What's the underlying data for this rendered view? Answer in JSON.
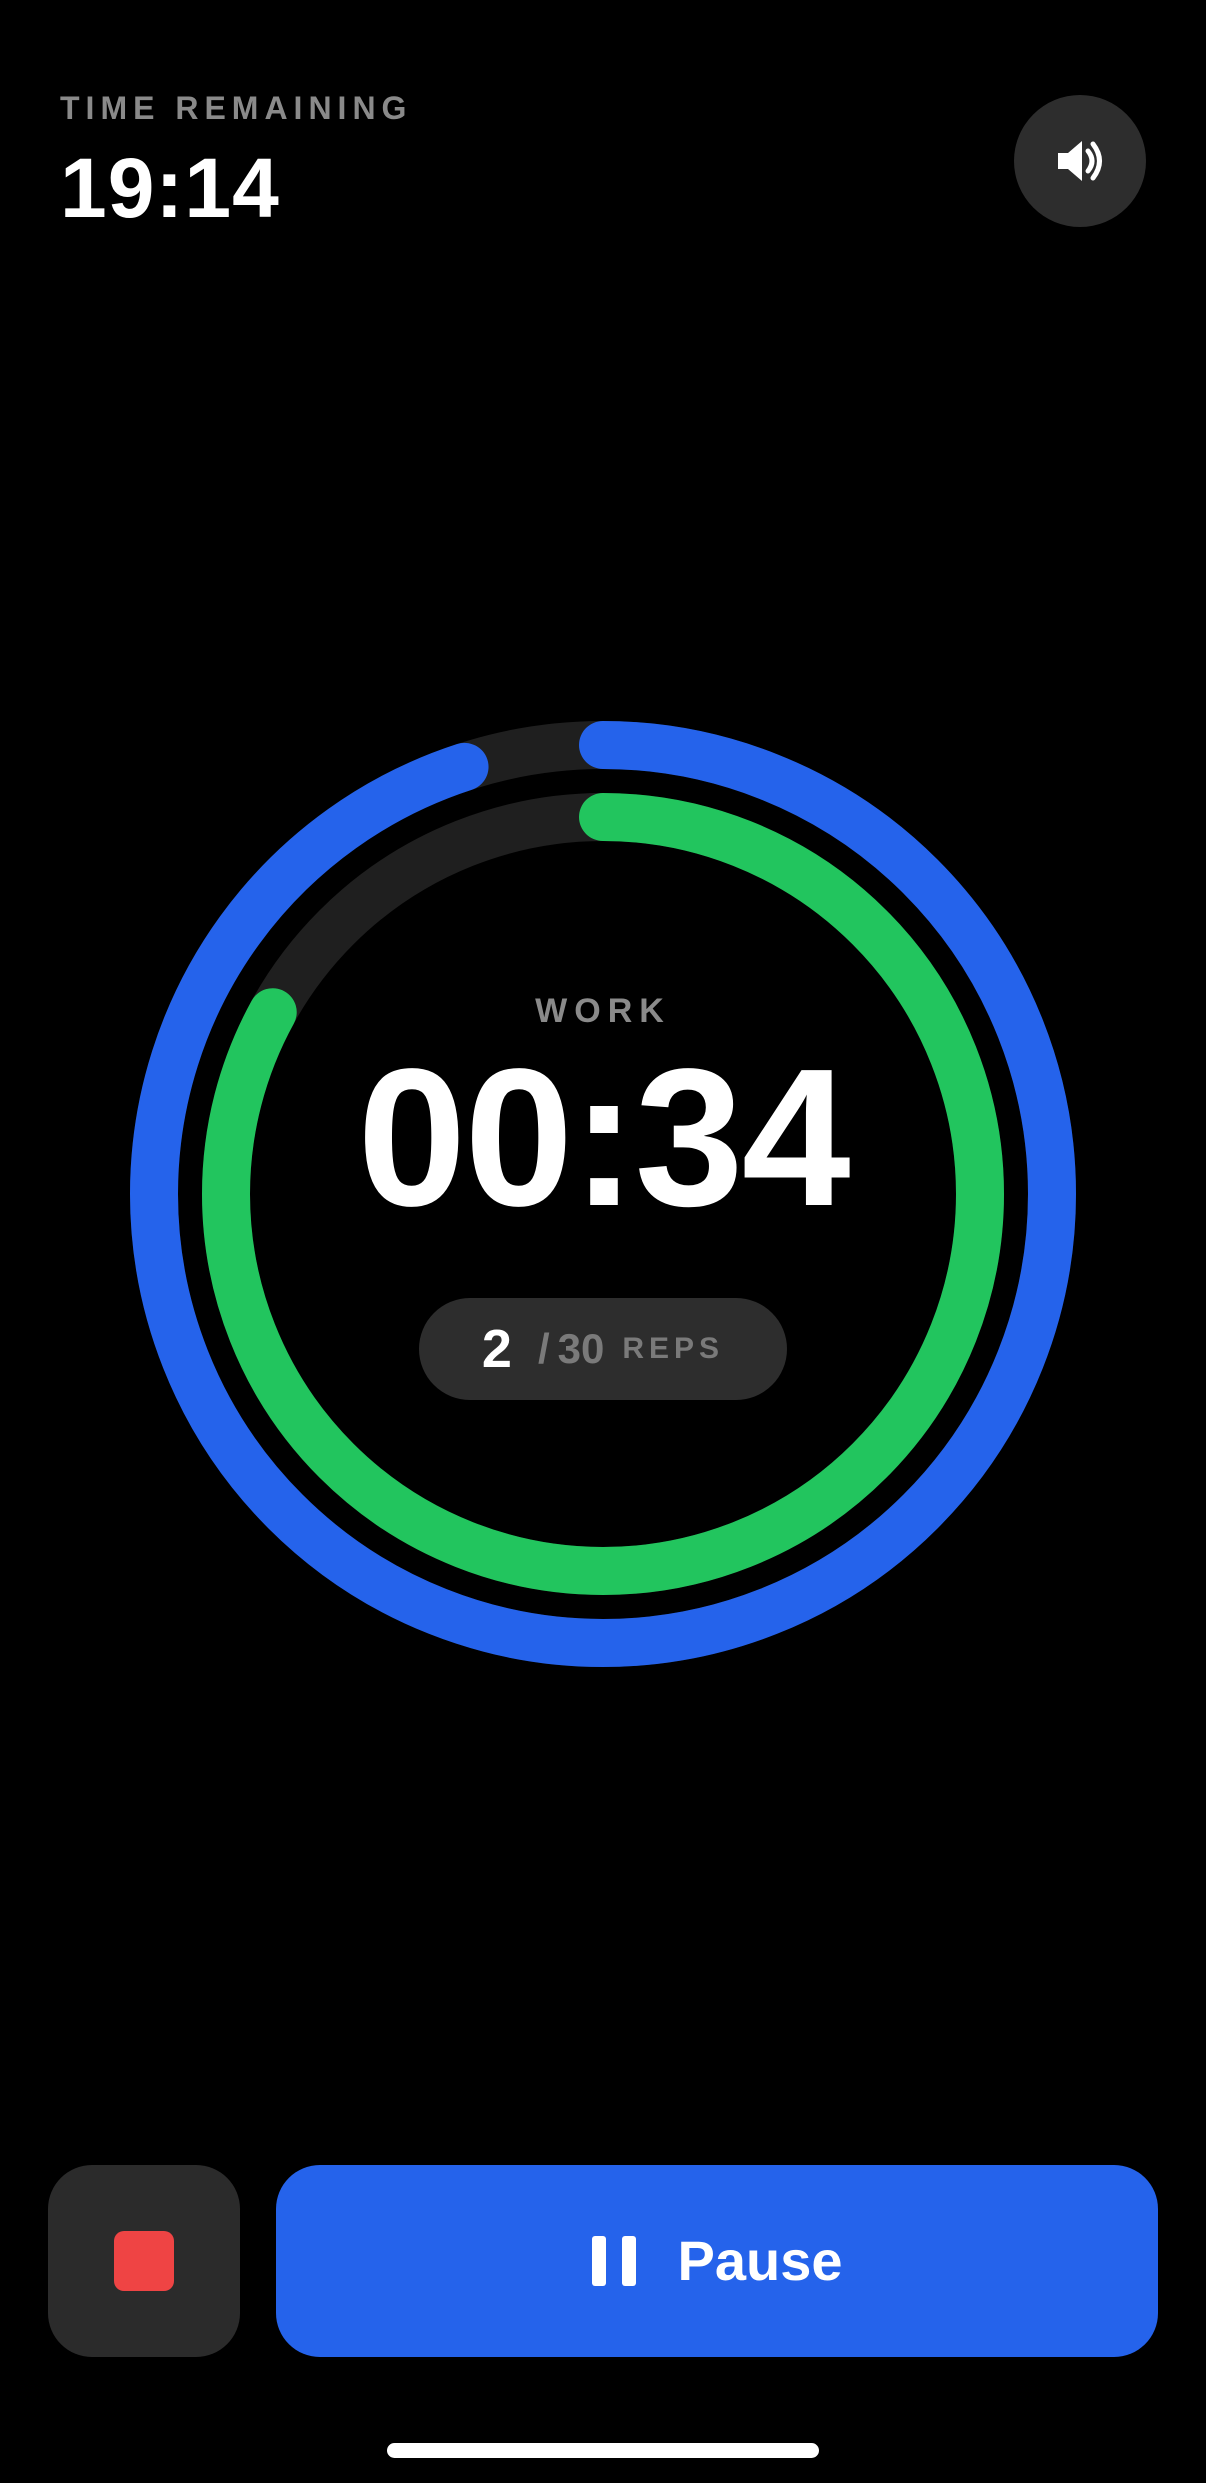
{
  "header": {
    "time_remaining_label": "TIME REMAINING",
    "time_remaining_value": "19:14",
    "sound_icon": "speaker-volume-icon"
  },
  "timer": {
    "phase": "WORK",
    "interval_time": "00:34",
    "reps_current": "2",
    "reps_separator": "/",
    "reps_total": "30",
    "reps_unit": "REPS",
    "overall_progress": 0.95,
    "interval_progress": 0.83
  },
  "controls": {
    "stop_icon": "stop-icon",
    "pause_icon": "pause-icon",
    "pause_label": "Pause"
  },
  "colors": {
    "background": "#000000",
    "overall_ring": "#2563eb",
    "interval_ring": "#22c55e",
    "ring_track": "#1f1f1f",
    "stop": "#ef4444",
    "pause_button": "#2563eb"
  }
}
